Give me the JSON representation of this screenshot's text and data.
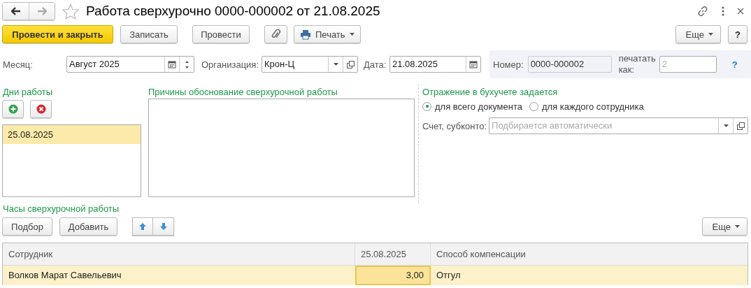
{
  "window": {
    "title": "Работа сверхурочно 0000-000002 от 21.08.2025"
  },
  "toolbar": {
    "buttons": [
      {
        "label": "Провести и закрыть",
        "kind": "primary"
      },
      {
        "label": "Записать",
        "kind": "button"
      },
      {
        "label": "Провести",
        "kind": "button"
      },
      {
        "kind": "attach"
      },
      {
        "label": "Печать",
        "kind": "menu"
      }
    ],
    "right_buttons": [
      {
        "label": "Еще",
        "kind": "more"
      },
      {
        "label": "?",
        "kind": "help"
      }
    ]
  },
  "header": {
    "month": {
      "label": "Месяц:",
      "value": "Август 2025"
    },
    "organization": {
      "label": "Организация:",
      "value": "Крон-Ц"
    },
    "date": {
      "label": "Дата:",
      "value": "21.08.2025"
    },
    "number": {
      "label": "Номер:",
      "value": "0000-000002"
    },
    "print_as": {
      "label": "печатать как:",
      "placeholder": "2"
    },
    "help": "?"
  },
  "work_days": {
    "title": "Дни работы",
    "items": [
      {
        "text": "25.08.2025",
        "selected": true
      }
    ]
  },
  "reasons": {
    "title": "Причины обоснование сверхурочной работы"
  },
  "accounting": {
    "title": "Отражение в бухучете задается",
    "options": [
      {
        "label": "для всего документа",
        "selected": true
      },
      {
        "label": "для каждого сотрудника",
        "selected": false
      }
    ],
    "account": {
      "label": "Счет, субконто:",
      "placeholder": "Подбирается автоматически"
    }
  },
  "hours": {
    "title": "Часы сверхурочной работы",
    "buttons": [
      {
        "label": "Подбор",
        "kind": "button"
      },
      {
        "label": "Добавить",
        "kind": "button"
      },
      {
        "kind": "up"
      },
      {
        "kind": "down"
      }
    ],
    "right_buttons": [
      {
        "label": "Еще",
        "kind": "more"
      }
    ],
    "table": {
      "columns": [
        "Сотрудник",
        "25.08.2025",
        "Способ компенсации"
      ],
      "rows": [
        {
          "selected": true,
          "cells": [
            {
              "text": "Волков Марат Савельевич",
              "selected": false
            },
            {
              "text": "3,00",
              "selected": true
            },
            {
              "text": "Отгул",
              "selected": false
            }
          ]
        }
      ]
    }
  }
}
